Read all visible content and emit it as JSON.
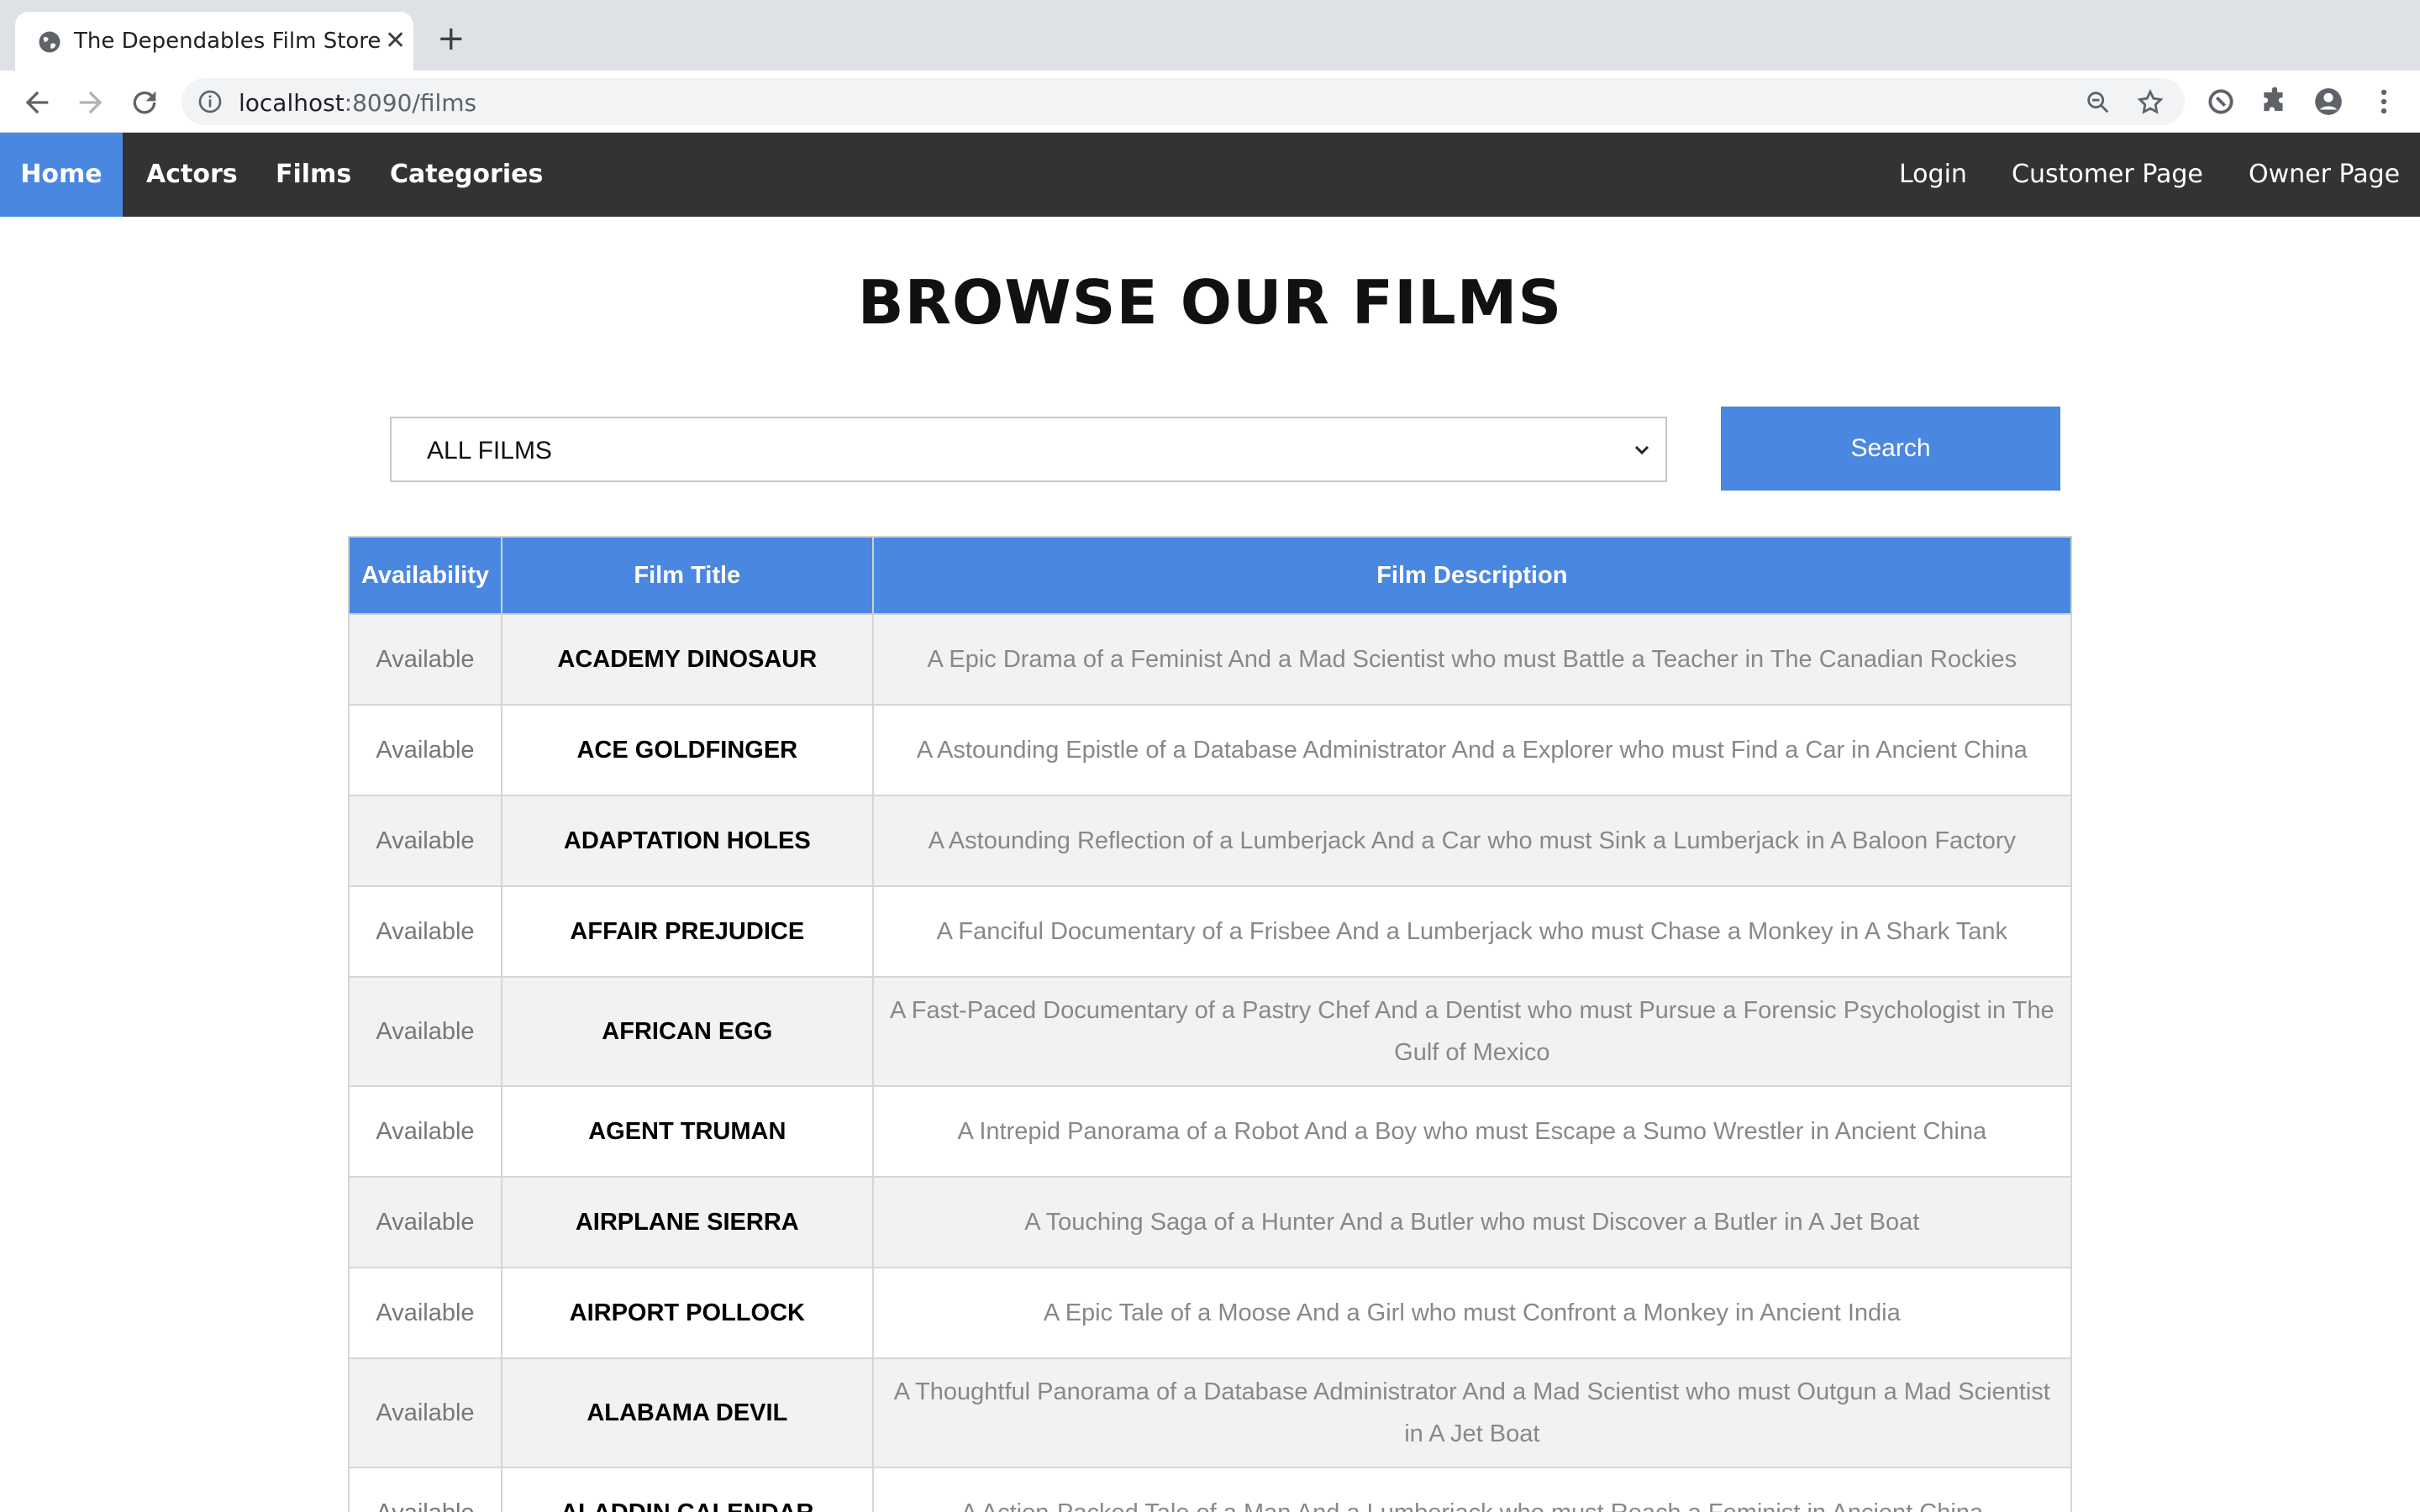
{
  "browser": {
    "tab_title": "The Dependables Film Store",
    "url_host": "localhost",
    "url_path": ":8090/films"
  },
  "nav": {
    "home": "Home",
    "actors": "Actors",
    "films": "Films",
    "categories": "Categories",
    "login": "Login",
    "customer_page": "Customer Page",
    "owner_page": "Owner Page",
    "active_color": "#4a87e0"
  },
  "main": {
    "title": "BROWSE OUR FILMS",
    "select_value": "ALL FILMS",
    "search_label": "Search"
  },
  "table": {
    "headers": [
      "Availability",
      "Film Title",
      "Film Description"
    ],
    "rows": [
      {
        "availability": "Available",
        "title": "ACADEMY DINOSAUR",
        "description": "A Epic Drama of a Feminist And a Mad Scientist who must Battle a Teacher in The Canadian Rockies"
      },
      {
        "availability": "Available",
        "title": "ACE GOLDFINGER",
        "description": "A Astounding Epistle of a Database Administrator And a Explorer who must Find a Car in Ancient China"
      },
      {
        "availability": "Available",
        "title": "ADAPTATION HOLES",
        "description": "A Astounding Reflection of a Lumberjack And a Car who must Sink a Lumberjack in A Baloon Factory"
      },
      {
        "availability": "Available",
        "title": "AFFAIR PREJUDICE",
        "description": "A Fanciful Documentary of a Frisbee And a Lumberjack who must Chase a Monkey in A Shark Tank"
      },
      {
        "availability": "Available",
        "title": "AFRICAN EGG",
        "description": "A Fast-Paced Documentary of a Pastry Chef And a Dentist who must Pursue a Forensic Psychologist in The Gulf of Mexico"
      },
      {
        "availability": "Available",
        "title": "AGENT TRUMAN",
        "description": "A Intrepid Panorama of a Robot And a Boy who must Escape a Sumo Wrestler in Ancient China"
      },
      {
        "availability": "Available",
        "title": "AIRPLANE SIERRA",
        "description": "A Touching Saga of a Hunter And a Butler who must Discover a Butler in A Jet Boat"
      },
      {
        "availability": "Available",
        "title": "AIRPORT POLLOCK",
        "description": "A Epic Tale of a Moose And a Girl who must Confront a Monkey in Ancient India"
      },
      {
        "availability": "Available",
        "title": "ALABAMA DEVIL",
        "description": "A Thoughtful Panorama of a Database Administrator And a Mad Scientist who must Outgun a Mad Scientist in A Jet Boat"
      },
      {
        "availability": "Available",
        "title": "ALADDIN CALENDAR",
        "description": "A Action-Packed Tale of a Man And a Lumberjack who must Reach a Feminist in Ancient China"
      }
    ]
  }
}
